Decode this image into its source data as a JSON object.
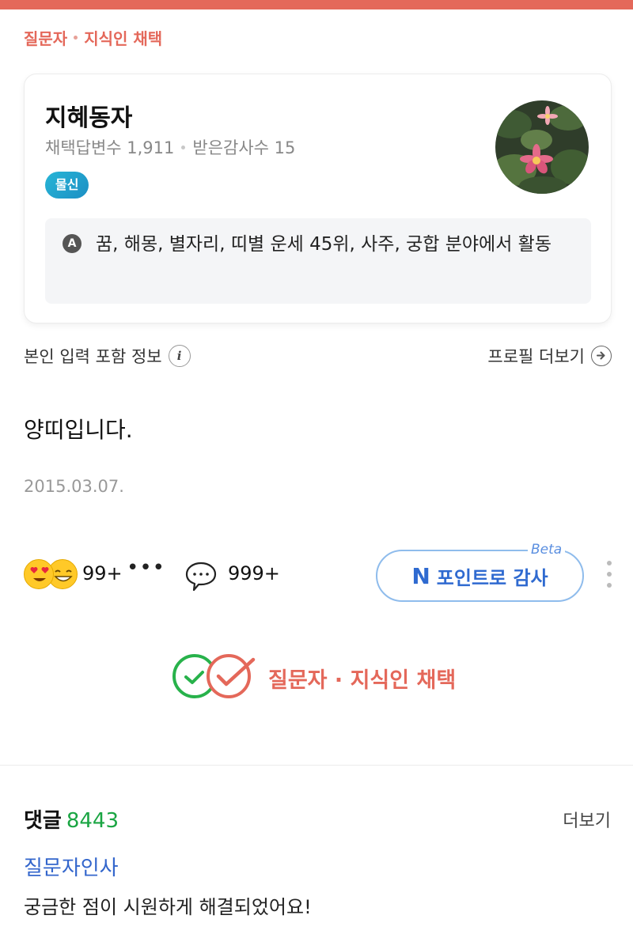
{
  "header": {
    "selected_part1": "질문자",
    "selected_part2": "지식인 채택"
  },
  "profile": {
    "name": "지혜동자",
    "stats_selected": "채택답변수 1,911",
    "stats_thanks": "받은감사수 15",
    "badge": "물신",
    "activity_icon_letter": "A",
    "activity": "꿈, 해몽, 별자리, 띠별 운세 45위, 사주, 궁합 분야에서 활동"
  },
  "info_row": {
    "left_label": "본인 입력 포함 정보",
    "info_icon": "i",
    "profile_more": "프로필 더보기"
  },
  "answer": {
    "text": "양띠입니다.",
    "date": "2015.03.07."
  },
  "reactions": {
    "count": "99+",
    "more": "•••",
    "comment_count": "999+",
    "point_button": "포인트로 감사",
    "point_mark": "N",
    "beta": "Beta"
  },
  "adopted": {
    "label": "질문자 · 지식인 채택"
  },
  "comments": {
    "title": "댓글",
    "count": "8443",
    "more": "더보기",
    "author": "질문자인사",
    "body": "궁금한 점이 시원하게 해결되었어요!"
  },
  "colors": {
    "accent_red": "#e4685a",
    "accent_blue": "#2f6ad0",
    "comment_green": "#1aa543",
    "badge_teal": "#27b5d6"
  },
  "icons": [
    "info-icon",
    "arrow-right-circle-icon",
    "heart-eyes-emoji-icon",
    "grin-emoji-icon",
    "speech-bubble-icon",
    "kebab-menu-icon",
    "check-circle-icon"
  ]
}
